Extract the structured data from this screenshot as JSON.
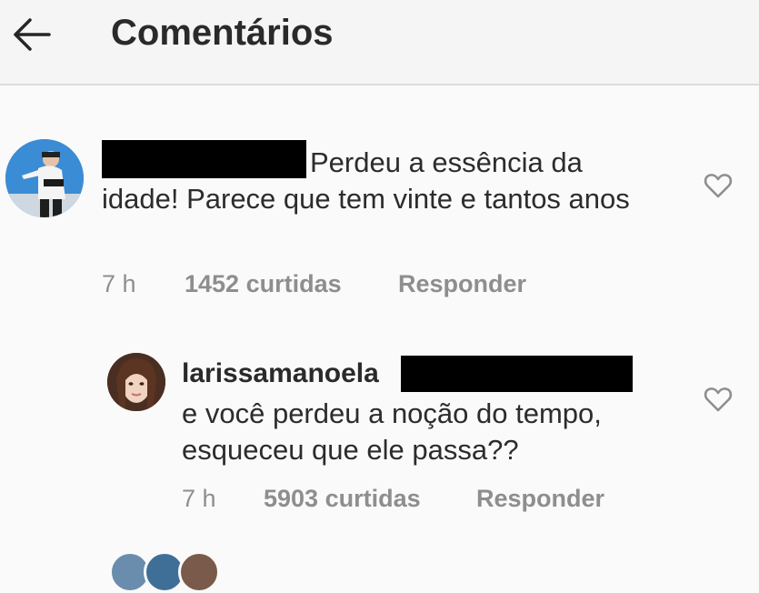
{
  "header": {
    "back_icon": "arrow-left-icon",
    "title": "Comentários"
  },
  "comments": [
    {
      "username_redacted": true,
      "text_first": "Perdeu a essência da",
      "text_rest": "idade! Parece que tem vinte e tantos anos",
      "time": "7 h",
      "likes": "1452 curtidas",
      "reply_label": "Responder",
      "like_icon": "heart-outline-icon"
    },
    {
      "username": "larissamanoela",
      "mention_redacted": true,
      "text": "e você perdeu a noção do tempo, esqueceu que ele passa??",
      "time": "7 h",
      "likes": "5903 curtidas",
      "reply_label": "Responder",
      "like_icon": "heart-outline-icon"
    }
  ]
}
